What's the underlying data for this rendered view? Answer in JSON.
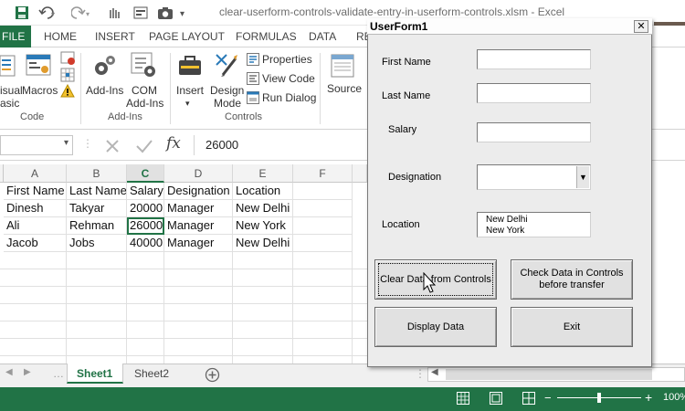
{
  "window": {
    "title": "clear-userform-controls-validate-entry-in-userform-controls.xlsm - Excel"
  },
  "ribbon": {
    "tabs": [
      "FILE",
      "HOME",
      "INSERT",
      "PAGE LAYOUT",
      "FORMULAS",
      "DATA",
      "RE"
    ],
    "code_group": {
      "visual_basic_1": "isual",
      "visual_basic_2": "asic",
      "macros": "Macros",
      "label": "Code"
    },
    "addins_group": {
      "addins": "Add-Ins",
      "com_1": "COM",
      "com_2": "Add-Ins",
      "label": "Add-Ins"
    },
    "controls_group": {
      "insert": "Insert",
      "design_1": "Design",
      "design_2": "Mode",
      "properties": "Properties",
      "view_code": "View Code",
      "run_dialog": "Run Dialog",
      "label": "Controls"
    },
    "source": "Source"
  },
  "formula_bar": {
    "fx": "fx",
    "value": "26000"
  },
  "sheet": {
    "columns": [
      "A",
      "B",
      "C",
      "D",
      "E",
      "F"
    ],
    "header_row": [
      "First Name",
      "Last Name",
      "Salary",
      "Designation",
      "Location"
    ],
    "rows": [
      [
        "Dinesh",
        "Takyar",
        "20000",
        "Manager",
        "New Delhi"
      ],
      [
        "Ali",
        "Rehman",
        "26000",
        "Manager",
        "New York"
      ],
      [
        "Jacob",
        "Jobs",
        "40000",
        "Manager",
        "New Delhi"
      ]
    ],
    "tabs": [
      "Sheet1",
      "Sheet2"
    ]
  },
  "status": {
    "zoom": "100%"
  },
  "userform": {
    "title": "UserForm1",
    "close": "✕",
    "labels": {
      "first_name": "First Name",
      "last_name": "Last Name",
      "salary": "Salary",
      "designation": "Designation",
      "location": "Location"
    },
    "location_list": [
      "New Delhi",
      "New York"
    ],
    "buttons": {
      "clear": "Clear Data from Controls",
      "check_1": "Check Data in Controls",
      "check_2": "before transfer",
      "display": "Display Data",
      "exit": "Exit"
    }
  }
}
